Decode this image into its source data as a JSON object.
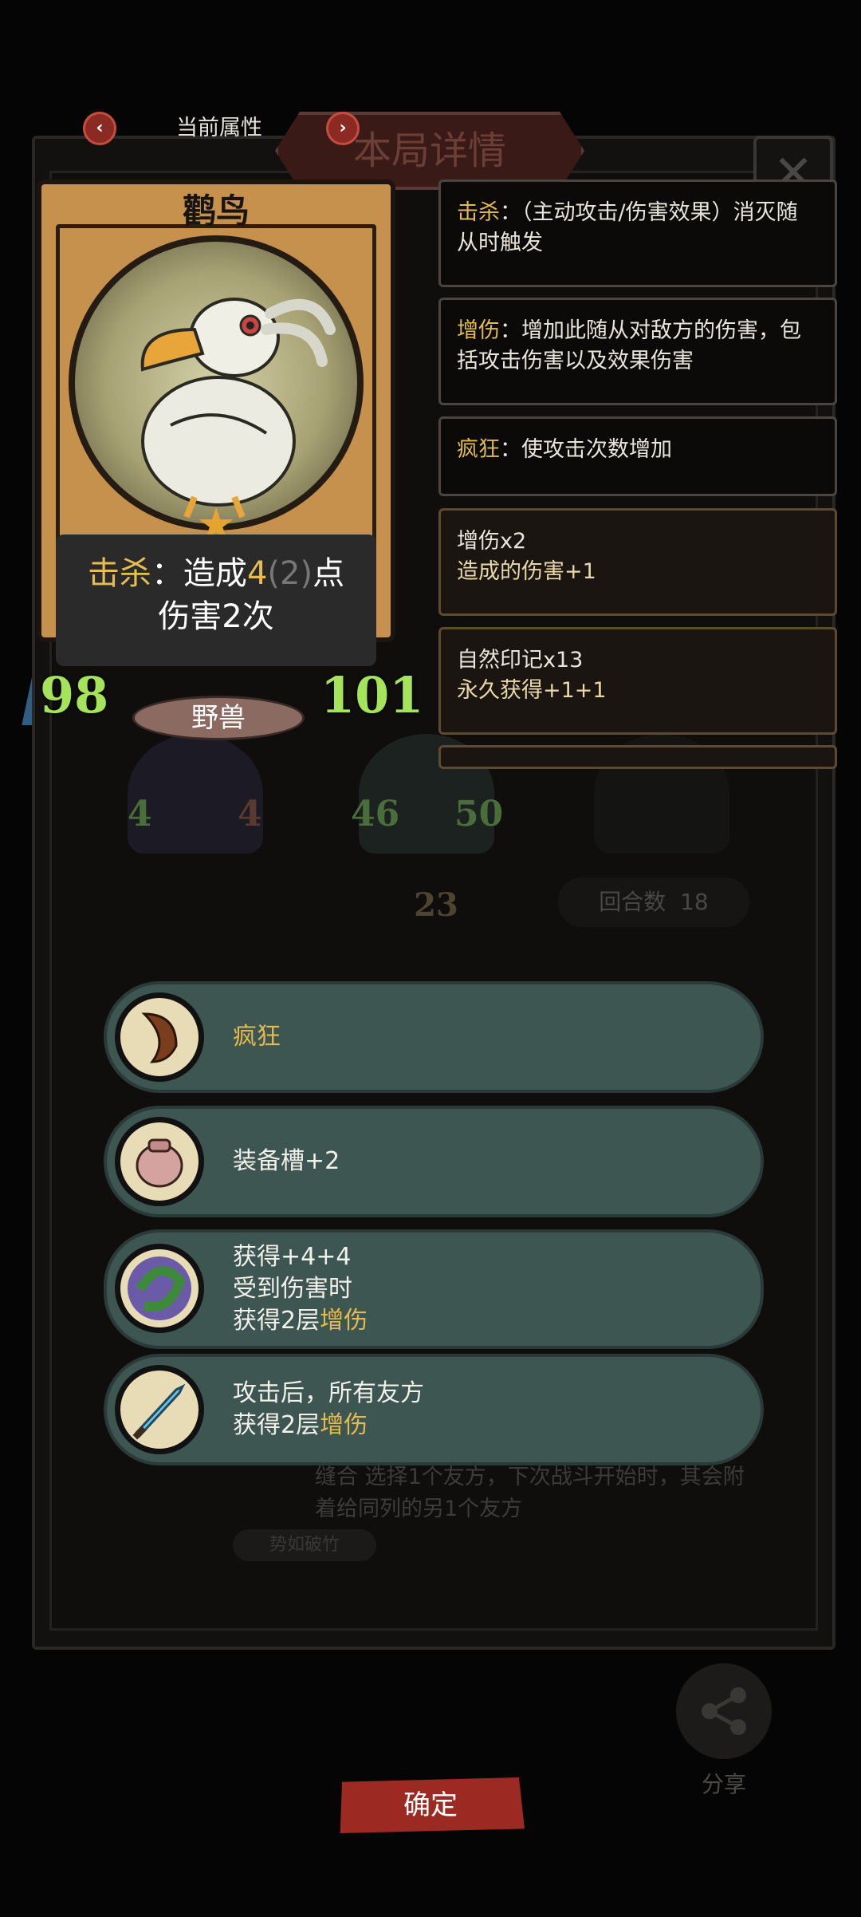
{
  "header": {
    "title": "当前属性",
    "prev_icon": "chevron-left-icon",
    "next_icon": "chevron-right-icon"
  },
  "background": {
    "panel_title": "本局详情",
    "close_label": "✕",
    "enemy_stats": [
      "4",
      "4",
      "46",
      "50"
    ],
    "turn_number": "23",
    "rounds_label": "回合数",
    "rounds_value": "18",
    "hint_text": "缝合 选择1个友方，下次战斗开始时，其会附着给同列的另1个友方",
    "tag_label": "势如破竹"
  },
  "card": {
    "name": "鹳鸟",
    "description_keyword": "击杀",
    "description_part1": "：造成",
    "description_value": "4",
    "description_base": "(2)",
    "description_part2": "点",
    "description_line2": "伤害2次",
    "attack": "98",
    "race": "野兽",
    "health": "101"
  },
  "info_boxes": [
    {
      "keyword": "击杀",
      "text": "：（主动攻击/伤害效果）消灭随从时触发"
    },
    {
      "keyword": "增伤",
      "text": "：增加此随从对敌方的伤害，包括攻击伤害以及效果伤害"
    },
    {
      "keyword": "疯狂",
      "text": "：使攻击次数增加"
    }
  ],
  "buff_boxes": [
    {
      "title": "增伤x2",
      "sub": "造成的伤害+1"
    },
    {
      "title": "自然印记x13",
      "sub": "永久获得+1+1"
    }
  ],
  "buffs": [
    {
      "icon": "horn-icon",
      "line1": "疯狂",
      "line2": "",
      "line3": ""
    },
    {
      "icon": "backpack-icon",
      "line1": "装备槽+2",
      "line2": "",
      "line3": ""
    },
    {
      "icon": "nature-leaf-icon",
      "line1": "获得+4+4",
      "line2": "受到伤害时",
      "line3_prefix": "获得2层",
      "line3_kw": "增伤"
    },
    {
      "icon": "ice-dagger-icon",
      "line1": "攻击后，所有友方",
      "line2_prefix": "获得2层",
      "line2_kw": "增伤"
    }
  ],
  "footer": {
    "confirm_label": "确定",
    "share_label": "分享",
    "share_icon": "share-icon"
  }
}
